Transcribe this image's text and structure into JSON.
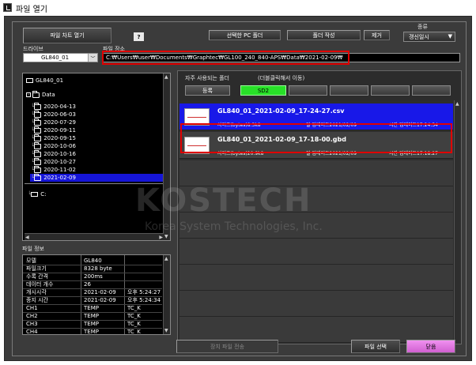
{
  "window": {
    "title": "파일 열기"
  },
  "top": {
    "open_chart_label": "파일 차트 열기",
    "help_label": "?",
    "drive_label": "드라이브",
    "drive_value": "GL840_01",
    "location_label": "파일 장소",
    "path_value": "C:₩Users₩user₩Documents₩Graphtec₩GL100_240_840-APS₩Data₩2021-02-09₩",
    "select_pc_folder_label": "선택한 PC 폴더",
    "create_folder_label": "폴더 작성",
    "remove_label": "제거",
    "sort_label": "종류",
    "sort_value": "갱신일시"
  },
  "tree": {
    "root": "GL840_01",
    "data_folder": "Data",
    "folders": [
      "2020-04-13",
      "2020-06-03",
      "2020-07-29",
      "2020-09-11",
      "2020-09-15",
      "2020-10-06",
      "2020-10-16",
      "2020-10-27",
      "2020-11-02",
      "2021-02-09"
    ],
    "drive_c": "C:"
  },
  "file_info": {
    "title": "파일 정보",
    "rows": [
      {
        "k": "모델",
        "v1": "GL840",
        "v2": ""
      },
      {
        "k": "파일크기",
        "v1": "8328 byte",
        "v2": ""
      },
      {
        "k": "수록 간격",
        "v1": "200ms",
        "v2": ""
      },
      {
        "k": "데이터 개수",
        "v1": "26",
        "v2": ""
      },
      {
        "k": "개시시각",
        "v1": "2021-02-09",
        "v2": "오후 5:24:27"
      },
      {
        "k": "종지 시간",
        "v1": "2021-02-09",
        "v2": "오후 5:24:34"
      },
      {
        "k": "CH1",
        "v1": "TEMP",
        "v2": "TC_K"
      },
      {
        "k": "CH2",
        "v1": "TEMP",
        "v2": "TC_K"
      },
      {
        "k": "CH3",
        "v1": "TEMP",
        "v2": "TC_K"
      },
      {
        "k": "CH4",
        "v1": "TEMP",
        "v2": "TC_K"
      }
    ]
  },
  "favorites": {
    "label": "자주 사용되는 폴더",
    "hint": "(더블클릭해서 이동)",
    "register_label": "등록",
    "sd2_label": "SD2"
  },
  "files": [
    {
      "name": "GL840_01_2021-02-09_17-24-27.csv",
      "size": "사이즈(bytes)8.3k8",
      "updated": "일 업데이트2021/02/09",
      "time": "시간 업데이트17:24:34"
    },
    {
      "name": "GL840_01_2021-02-09_17-18-00.gbd",
      "size": "사이즈(bytes)20.9k8",
      "updated": "일 업데이트2021/02/09",
      "time": "시간 업데이트17:18:27"
    }
  ],
  "bottom": {
    "device_transfer_label": "장치 파일 전송",
    "select_file_label": "파일 선택",
    "close_label": "닫음"
  },
  "watermark": {
    "big": "KOSTECH",
    "small": "Korea System Technologies, Inc."
  },
  "colors": {
    "accent_selected": "#1818e8",
    "highlight_red": "#e00000",
    "sd2_green": "#28e028",
    "close_pink": "#e070e0"
  }
}
